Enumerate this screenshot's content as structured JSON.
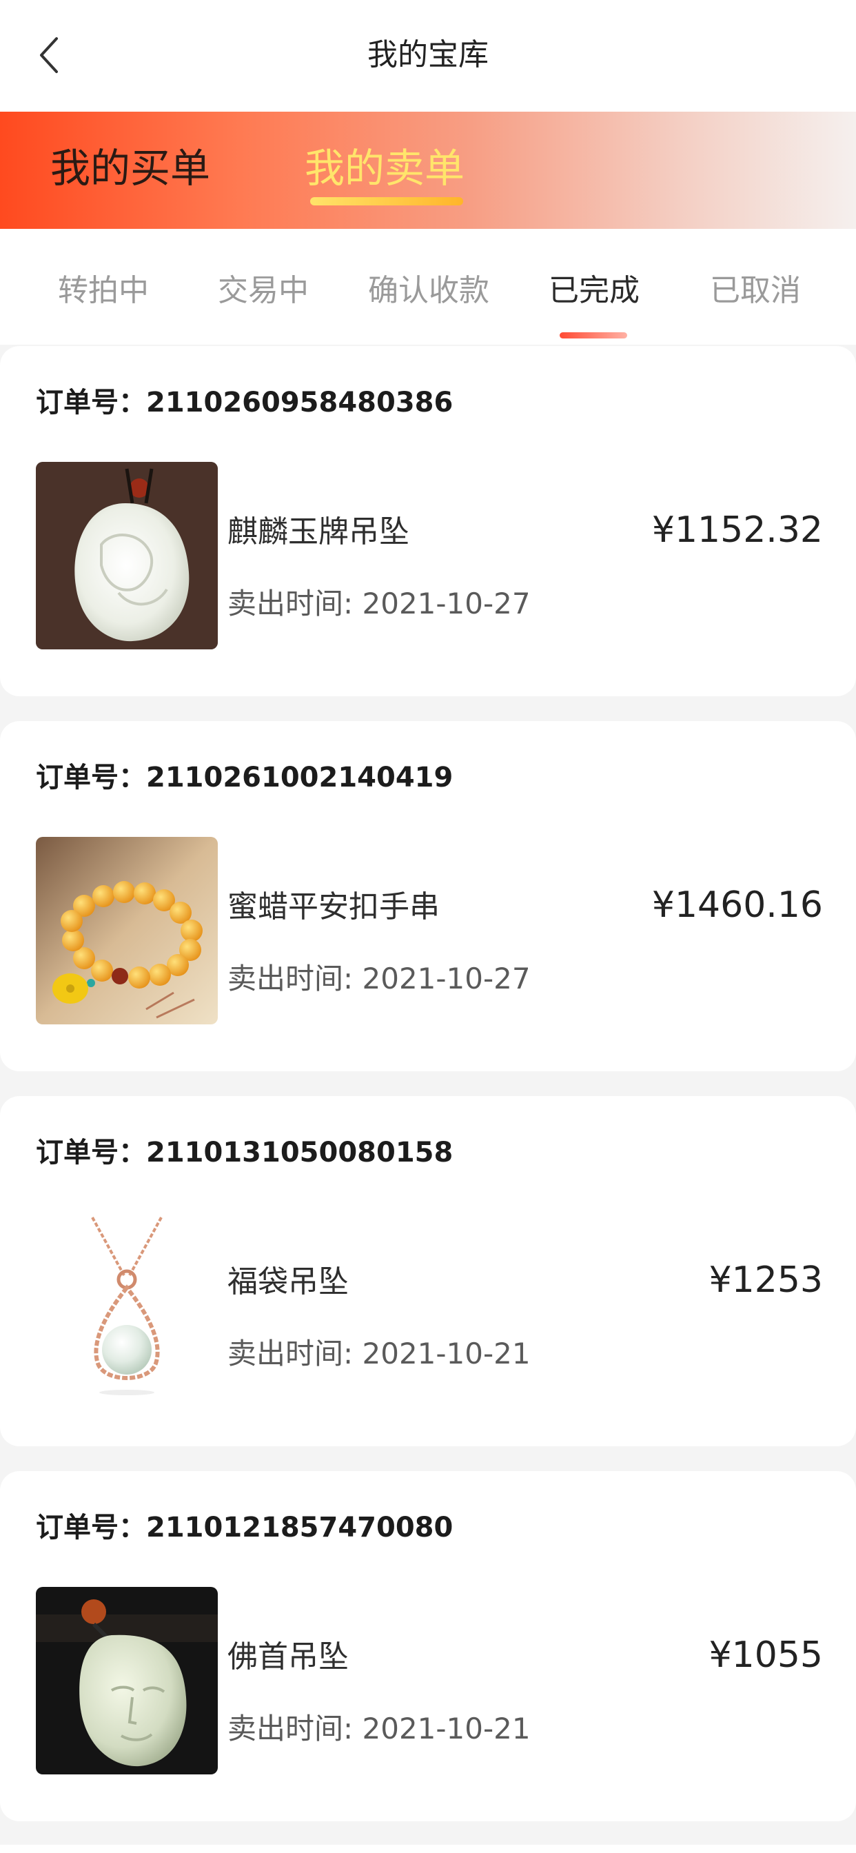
{
  "nav": {
    "title": "我的宝库",
    "back_icon": "chevron-left-icon"
  },
  "role_tabs": [
    {
      "label": "我的买单",
      "active": false
    },
    {
      "label": "我的卖单",
      "active": true
    }
  ],
  "status_tabs": [
    {
      "label": "转拍中",
      "active": false
    },
    {
      "label": "交易中",
      "active": false
    },
    {
      "label": "确认收款",
      "active": false
    },
    {
      "label": "已完成",
      "active": true
    },
    {
      "label": "已取消",
      "active": false
    }
  ],
  "colors": {
    "accent": "#ff4a1f",
    "active_role_text": "#ffe56b",
    "underline": "#ff4b34"
  },
  "orders": [
    {
      "order_label": "订单号：2110260958480386",
      "name": "麒麟玉牌吊坠",
      "sold_time": "卖出时间: 2021-10-27",
      "price": "¥1152.32",
      "image": "white-jade-qilin-pendant"
    },
    {
      "order_label": "订单号：2110261002140419",
      "name": "蜜蜡平安扣手串",
      "sold_time": "卖出时间: 2021-10-27",
      "price": "¥1460.16",
      "image": "amber-bead-bracelet"
    },
    {
      "order_label": "订单号：2110131050080158",
      "name": "福袋吊坠",
      "sold_time": "卖出时间: 2021-10-21",
      "price": "¥1253",
      "image": "rose-gold-jade-pendant-necklace"
    },
    {
      "order_label": "订单号：2110121857470080",
      "name": "佛首吊坠",
      "sold_time": "卖出时间: 2021-10-21",
      "price": "¥1055",
      "image": "jade-buddha-head-pendant"
    }
  ]
}
